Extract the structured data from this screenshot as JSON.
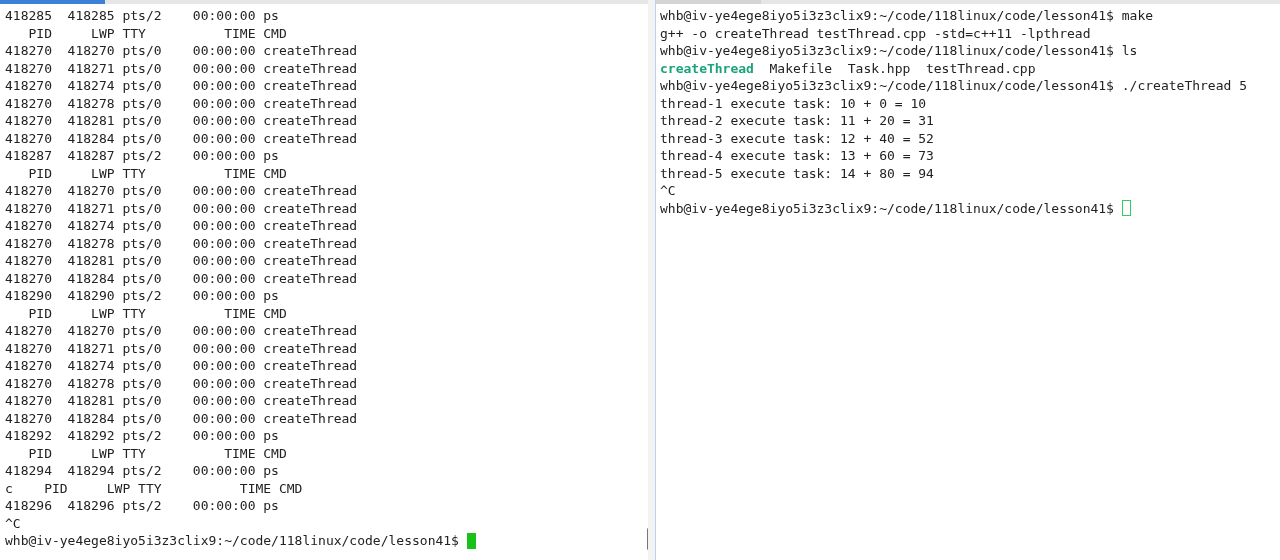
{
  "panes": [
    {
      "active": true,
      "lines": [
        {
          "text": "418285  418285 pts/2    00:00:00 ps"
        },
        {
          "text": "   PID     LWP TTY          TIME CMD"
        },
        {
          "text": "418270  418270 pts/0    00:00:00 createThread"
        },
        {
          "text": "418270  418271 pts/0    00:00:00 createThread"
        },
        {
          "text": "418270  418274 pts/0    00:00:00 createThread"
        },
        {
          "text": "418270  418278 pts/0    00:00:00 createThread"
        },
        {
          "text": "418270  418281 pts/0    00:00:00 createThread"
        },
        {
          "text": "418270  418284 pts/0    00:00:00 createThread"
        },
        {
          "text": "418287  418287 pts/2    00:00:00 ps"
        },
        {
          "text": "   PID     LWP TTY          TIME CMD"
        },
        {
          "text": "418270  418270 pts/0    00:00:00 createThread"
        },
        {
          "text": "418270  418271 pts/0    00:00:00 createThread"
        },
        {
          "text": "418270  418274 pts/0    00:00:00 createThread"
        },
        {
          "text": "418270  418278 pts/0    00:00:00 createThread"
        },
        {
          "text": "418270  418281 pts/0    00:00:00 createThread"
        },
        {
          "text": "418270  418284 pts/0    00:00:00 createThread"
        },
        {
          "text": "418290  418290 pts/2    00:00:00 ps"
        },
        {
          "text": "   PID     LWP TTY          TIME CMD"
        },
        {
          "text": "418270  418270 pts/0    00:00:00 createThread"
        },
        {
          "text": "418270  418271 pts/0    00:00:00 createThread"
        },
        {
          "text": "418270  418274 pts/0    00:00:00 createThread"
        },
        {
          "text": "418270  418278 pts/0    00:00:00 createThread"
        },
        {
          "text": "418270  418281 pts/0    00:00:00 createThread"
        },
        {
          "text": "418270  418284 pts/0    00:00:00 createThread"
        },
        {
          "text": "418292  418292 pts/2    00:00:00 ps"
        },
        {
          "text": "   PID     LWP TTY          TIME CMD"
        },
        {
          "text": "418294  418294 pts/2    00:00:00 ps"
        },
        {
          "text": "c    PID     LWP TTY          TIME CMD"
        },
        {
          "text": "418296  418296 pts/2    00:00:00 ps"
        },
        {
          "text": "^C"
        },
        {
          "text": "whb@iv-ye4ege8iyo5i3z3clix9:~/code/118linux/code/lesson41$ ",
          "cursor": true
        }
      ]
    },
    {
      "active": false,
      "lines": [
        {
          "text": "whb@iv-ye4ege8iyo5i3z3clix9:~/code/118linux/code/lesson41$ make"
        },
        {
          "text": "g++ -o createThread testThread.cpp -std=c++11 -lpthread"
        },
        {
          "text": "whb@iv-ye4ege8iyo5i3z3clix9:~/code/118linux/code/lesson41$ ls"
        },
        {
          "files": [
            {
              "text": "createThread",
              "kind": "executable"
            },
            {
              "text": "Makefile",
              "kind": "file"
            },
            {
              "text": "Task.hpp",
              "kind": "file"
            },
            {
              "text": "testThread.cpp",
              "kind": "file"
            }
          ]
        },
        {
          "text": "whb@iv-ye4ege8iyo5i3z3clix9:~/code/118linux/code/lesson41$ ./createThread 5"
        },
        {
          "text": "thread-1 execute task: 10 + 0 = 10"
        },
        {
          "text": "thread-2 execute task: 11 + 20 = 31"
        },
        {
          "text": "thread-3 execute task: 12 + 40 = 52"
        },
        {
          "text": "thread-4 execute task: 13 + 60 = 73"
        },
        {
          "text": "thread-5 execute task: 14 + 80 = 94"
        },
        {
          "text": "^C"
        },
        {
          "text": "whb@iv-ye4ege8iyo5i3z3clix9:~/code/118linux/code/lesson41$ ",
          "cursor": true
        }
      ]
    }
  ]
}
